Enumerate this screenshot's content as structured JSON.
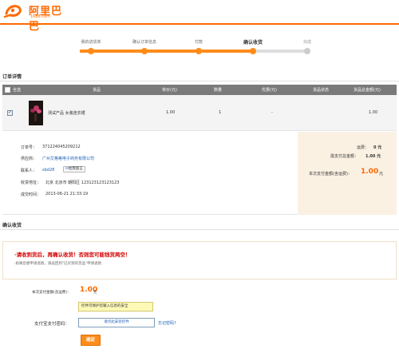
{
  "brand": {
    "name": "阿里巴巴",
    "domain": "1688.com",
    "color": "#ff6a00"
  },
  "progress": {
    "steps": [
      {
        "label": "我的进货单",
        "state": "done"
      },
      {
        "label": "确认订单信息",
        "state": "done"
      },
      {
        "label": "付款",
        "state": "done"
      },
      {
        "label": "确认收货",
        "state": "current"
      },
      {
        "label": "完成",
        "state": "future"
      }
    ],
    "active_color": "#ff8c1a",
    "inactive_color": "#dddddd"
  },
  "order_details": {
    "title": "订单详情",
    "columns": [
      "全选",
      "货品",
      "单价(元)",
      "数量",
      "优惠(元)",
      "货品状态",
      "货品总金额(元)"
    ],
    "row": {
      "product": "测试产品 女装连衣裙",
      "price": "1.00",
      "qty": "1",
      "discount": "-",
      "status": "",
      "total": "1.00"
    }
  },
  "info": {
    "order_no_label": "订单号：",
    "order_no": "371224045209212",
    "supplier_label": "供应商：",
    "supplier": "广州艾格格电子商务有限公司",
    "contact_label": "联系人：",
    "contact": "sbd28",
    "contact_btn": "给我留言",
    "address_label": "收货地址：",
    "address": "北京 北京市 朝阳区 123123123123123",
    "time_label": "成交时间：",
    "time": "2013-06-21 21:33:19",
    "shipping_label": "运费：",
    "shipping": "0 元",
    "payable_label": "需支付总金额：",
    "payable": "1.00 元",
    "paid_label": "本次支付金额(含运费)：",
    "paid_amount": "1.00",
    "paid_unit": "元"
  },
  "confirm": {
    "title": "确认收货",
    "warning": "·请收到货后，再确认收货！否则您可能钱货两空！",
    "tip": "·如果您想申请退款，请返回到\"已买到的货品\"申请退款",
    "pay_label": "本次支付金额(含运费)：",
    "pay_amount": "1.00",
    "pay_unit": "元",
    "tooltip": "控件可保护您输入信息的安全",
    "password_label": "支付宝支付密码：",
    "password_placeholder": "请点此安装控件",
    "forgot_link": "忘记密码?",
    "ok_button": "确定"
  }
}
